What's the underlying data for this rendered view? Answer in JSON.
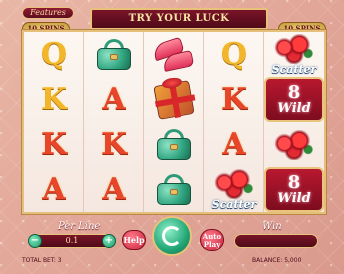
{
  "header": {
    "features_label": "Features",
    "title": "TRY YOUR LUCK",
    "free_spins_left": "10 SPINS",
    "free_spins_right": "10 SPINS"
  },
  "reels": [
    [
      "gold-Q",
      "gold-K",
      "red-K",
      "red-A"
    ],
    [
      "green-handbag",
      "red-A",
      "red-K",
      "red-A"
    ],
    [
      "red-heels",
      "gift-box",
      "green-handbag",
      "green-handbag"
    ],
    [
      "gold-Q",
      "red-K",
      "red-A",
      "roses-scatter"
    ],
    [
      "roses-scatter",
      "8-wild",
      "roses",
      "8-wild"
    ]
  ],
  "symbol_text": {
    "Q": "Q",
    "K": "K",
    "A": "A",
    "scatter": "Scatter",
    "wild_number": "8",
    "wild_label": "Wild"
  },
  "controls": {
    "per_line_label": "Per Line",
    "per_line_value": "0.1",
    "minus": "−",
    "plus": "+",
    "help": "Help",
    "auto_play": "Auto Play",
    "win_label": "Win"
  },
  "status": {
    "total_bet": "TOTAL BET: 3",
    "balance": "BALANCE: 5,000"
  },
  "colors": {
    "frame_gold": "#e7c27a",
    "banner_red": "#7a1428",
    "spin_green": "#22a676"
  }
}
